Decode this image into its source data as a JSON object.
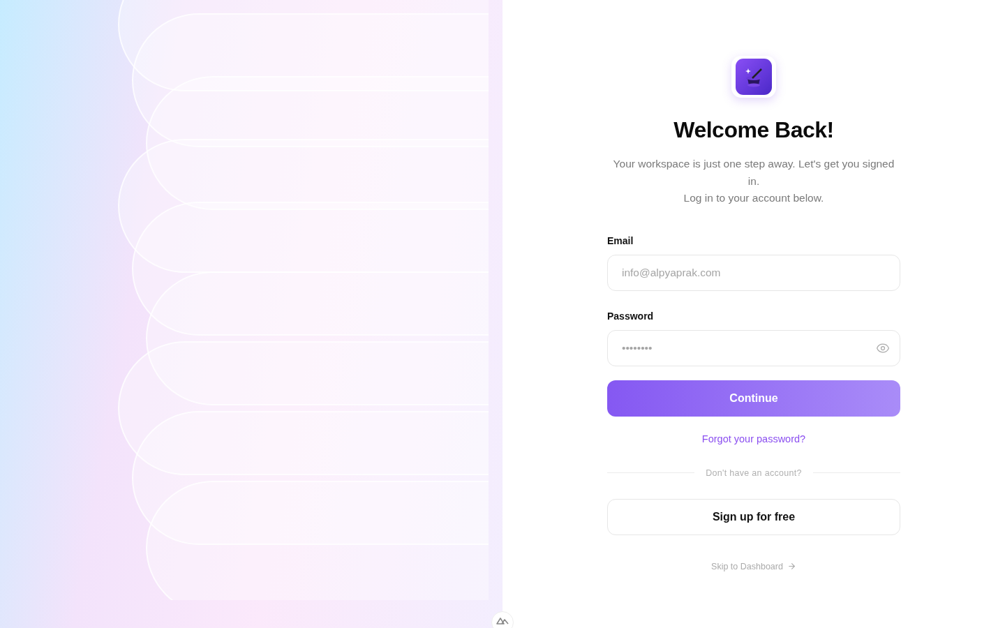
{
  "heading": "Welcome Back!",
  "subtitle_lines": [
    "Your workspace is just one step away. Let's get you signed in.",
    "Log in to your account below."
  ],
  "form": {
    "fields": [
      {
        "kind": "email",
        "label": "Email",
        "placeholder": "info@alpyaprak.com"
      },
      {
        "kind": "password",
        "label": "Password",
        "placeholder": "••••••••"
      }
    ],
    "submit": "Continue",
    "forgot_link": "Forgot your password?"
  },
  "divider_text": "Don't have an account?",
  "signup_button": "Sign up for free",
  "skip_link": "Skip to Dashboard"
}
